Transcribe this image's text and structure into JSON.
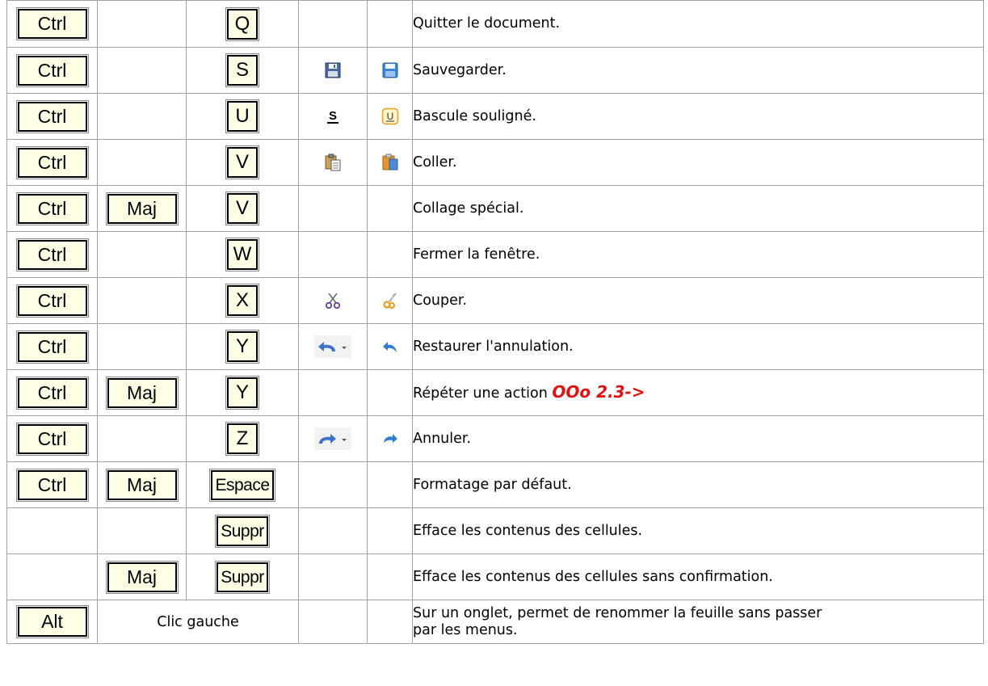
{
  "rows": [
    {
      "keys": [
        "Ctrl",
        "",
        "Q"
      ],
      "icon_a": "",
      "icon_b": "",
      "description": "Quitter le document."
    },
    {
      "keys": [
        "Ctrl",
        "",
        "S"
      ],
      "icon_a": "floppy-disk-icon",
      "icon_b": "save-icon",
      "description": "Sauvegarder."
    },
    {
      "keys": [
        "Ctrl",
        "",
        "U"
      ],
      "icon_a": "underline-icon",
      "icon_b": "underline-button-icon",
      "description": "Bascule souligné."
    },
    {
      "keys": [
        "Ctrl",
        "",
        "V"
      ],
      "icon_a": "paste-icon",
      "icon_b": "clipboard-icon",
      "description": "Coller."
    },
    {
      "keys": [
        "Ctrl",
        "Maj",
        "V"
      ],
      "icon_a": "",
      "icon_b": "",
      "description": "Collage spécial."
    },
    {
      "keys": [
        "Ctrl",
        "",
        "W"
      ],
      "icon_a": "",
      "icon_b": "",
      "description": "Fermer la fenêtre."
    },
    {
      "keys": [
        "Ctrl",
        "",
        "X"
      ],
      "icon_a": "scissors-icon",
      "icon_b": "cut-icon",
      "description": "Couper."
    },
    {
      "keys": [
        "Ctrl",
        "",
        "Y"
      ],
      "icon_a": "redo-dropdown-icon",
      "icon_b": "redo-arrow-icon",
      "description": "Restaurer l'annulation."
    },
    {
      "keys": [
        "Ctrl",
        "Maj",
        "Y"
      ],
      "icon_a": "",
      "icon_b": "",
      "description": "Répéter une action",
      "highlight": "OOo 2.3->"
    },
    {
      "keys": [
        "Ctrl",
        "",
        "Z"
      ],
      "icon_a": "undo-dropdown-icon",
      "icon_b": "undo-arrow-icon",
      "description": "Annuler."
    },
    {
      "keys": [
        "Ctrl",
        "Maj",
        "Espace"
      ],
      "icon_a": "",
      "icon_b": "",
      "description": "Formatage par défaut."
    },
    {
      "keys": [
        "",
        "",
        "Suppr"
      ],
      "icon_a": "",
      "icon_b": "",
      "description": "Efface les contenus des cellules."
    },
    {
      "keys": [
        "",
        "Maj",
        "Suppr"
      ],
      "icon_a": "",
      "icon_b": "",
      "description": "Efface les contenus des cellules sans confirmation."
    },
    {
      "keys": [
        "Alt"
      ],
      "mouse": "Clic gauche",
      "icon_a": "",
      "icon_b": "",
      "description_lines": [
        "Sur un onglet, permet de renommer la feuille sans passer",
        "par les menus."
      ]
    }
  ],
  "colors": {
    "key_bg": "#ffffe6",
    "border": "#a0a0a0",
    "highlight": "#e01212"
  }
}
